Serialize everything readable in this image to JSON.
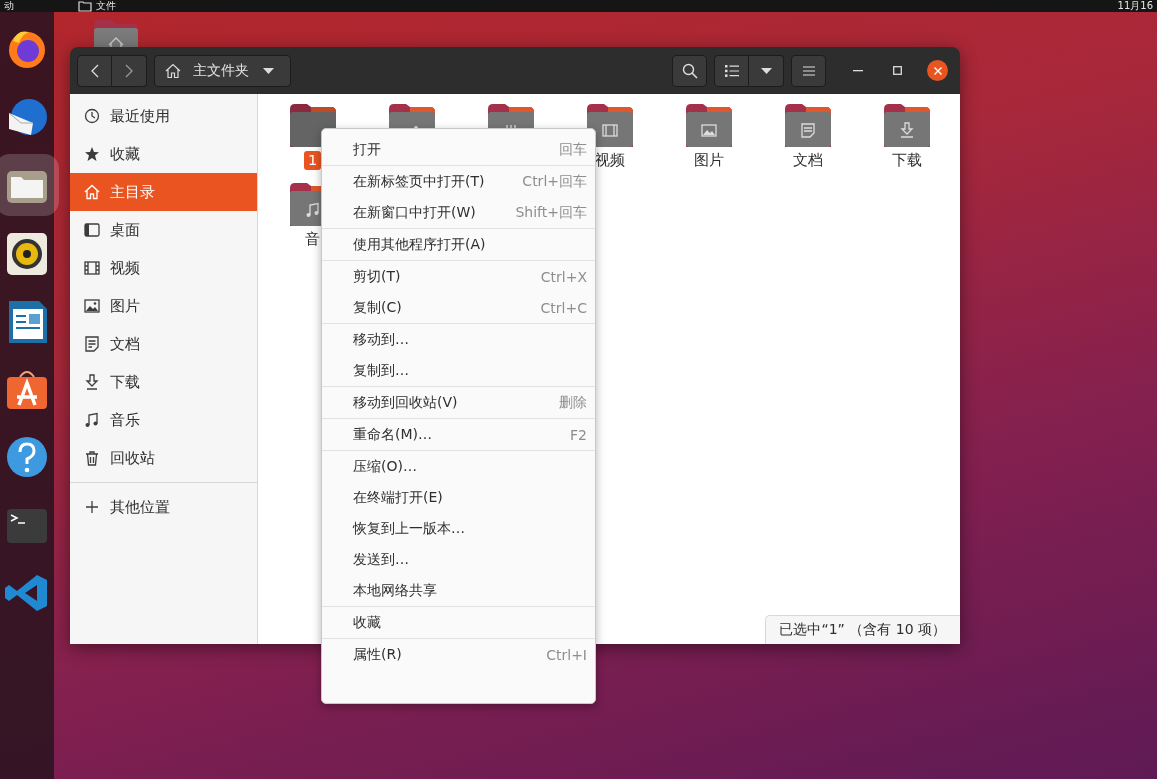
{
  "top_bar": {
    "activities": "动",
    "app_menu": "文件",
    "clock": "11月16"
  },
  "dock": [
    {
      "kind": "firefox",
      "selected": false
    },
    {
      "kind": "mail",
      "selected": false
    },
    {
      "kind": "files",
      "selected": true
    },
    {
      "kind": "speaker",
      "selected": false
    },
    {
      "kind": "writer",
      "selected": false
    },
    {
      "kind": "store",
      "selected": false
    },
    {
      "kind": "help",
      "selected": false
    },
    {
      "kind": "terminal",
      "selected": false
    },
    {
      "kind": "code",
      "selected": false
    }
  ],
  "window": {
    "path": "主文件夹"
  },
  "sidebar": {
    "places": [
      {
        "kind": "recent",
        "label": "最近使用",
        "selected": false
      },
      {
        "kind": "starred",
        "label": "收藏",
        "selected": false
      },
      {
        "kind": "home",
        "label": "主目录",
        "selected": true
      },
      {
        "kind": "desktop",
        "label": "桌面",
        "selected": false
      },
      {
        "kind": "video",
        "label": "视频",
        "selected": false
      },
      {
        "kind": "pictures",
        "label": "图片",
        "selected": false
      },
      {
        "kind": "documents",
        "label": "文档",
        "selected": false
      },
      {
        "kind": "downloads",
        "label": "下载",
        "selected": false
      },
      {
        "kind": "music",
        "label": "音乐",
        "selected": false
      },
      {
        "kind": "trash",
        "label": "回收站",
        "selected": false
      }
    ],
    "other": [
      {
        "kind": "plus",
        "label": "其他位置",
        "selected": false
      }
    ]
  },
  "files": [
    {
      "kind": "plain",
      "label": "1",
      "selected": true
    },
    {
      "kind": "share",
      "selected": false
    },
    {
      "kind": "templates",
      "selected": false
    },
    {
      "kind": "video",
      "label": "视频",
      "selected": false
    },
    {
      "kind": "pictures",
      "label": "图片",
      "selected": false
    },
    {
      "kind": "documents",
      "label": "文档",
      "selected": false
    },
    {
      "kind": "downloads",
      "label": "下载",
      "selected": false
    },
    {
      "kind": "music",
      "label": "音",
      "selected": false
    }
  ],
  "status": "已选中“1” （含有 10 项）",
  "context_menu": [
    [
      {
        "label": "打开",
        "shortcut": "回车"
      }
    ],
    [
      {
        "label": "在新标签页中打开(T)",
        "shortcut": "Ctrl+回车"
      },
      {
        "label": "在新窗口中打开(W)",
        "shortcut": "Shift+回车"
      }
    ],
    [
      {
        "label": "使用其他程序打开(A)"
      }
    ],
    [
      {
        "label": "剪切(T)",
        "shortcut": "Ctrl+X"
      },
      {
        "label": "复制(C)",
        "shortcut": "Ctrl+C"
      }
    ],
    [
      {
        "label": "移动到…"
      },
      {
        "label": "复制到…"
      }
    ],
    [
      {
        "label": "移动到回收站(V)",
        "shortcut": "删除"
      }
    ],
    [
      {
        "label": "重命名(M)…",
        "shortcut": "F2"
      }
    ],
    [
      {
        "label": "压缩(O)…"
      },
      {
        "label": "在终端打开(E)"
      },
      {
        "label": "恢复到上一版本…"
      },
      {
        "label": "发送到…"
      },
      {
        "label": "本地网络共享"
      }
    ],
    [
      {
        "label": "收藏"
      }
    ],
    [
      {
        "label": "属性(R)",
        "shortcut": "Ctrl+I"
      }
    ]
  ]
}
